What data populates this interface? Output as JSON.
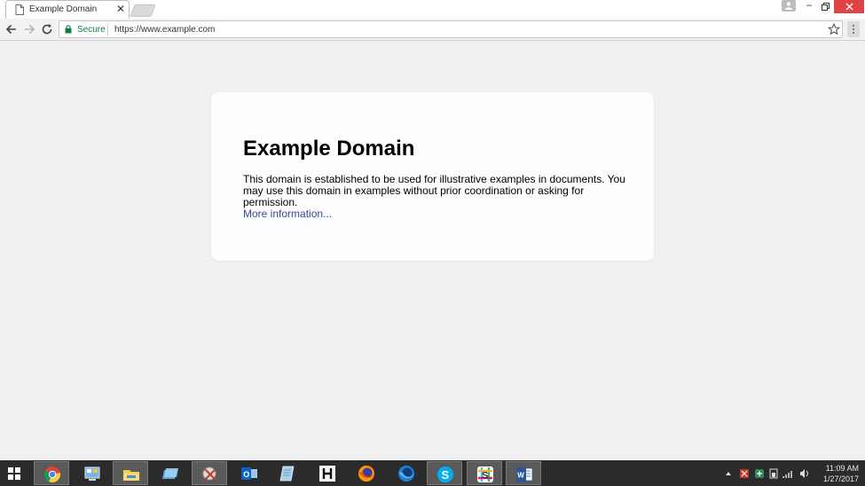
{
  "browser": {
    "tab": {
      "title": "Example Domain",
      "close_glyph": "✕"
    },
    "window_controls": {
      "minimize": "–"
    },
    "toolbar": {
      "secure_label": "Secure",
      "url": "https://www.example.com"
    }
  },
  "page": {
    "heading": "Example Domain",
    "body": "This domain is established to be used for illustrative examples in documents. You may use this domain in examples without prior coordination or asking for permission.",
    "link": "More information..."
  },
  "taskbar": {
    "apps": [
      {
        "name": "chrome-icon",
        "active": true
      },
      {
        "name": "control-panel-icon",
        "active": false
      },
      {
        "name": "file-explorer-icon",
        "active": false
      },
      {
        "name": "folder-app-icon",
        "active": false
      },
      {
        "name": "snipping-tool-icon",
        "active": true
      },
      {
        "name": "outlook-icon",
        "active": false
      },
      {
        "name": "notepad-icon",
        "active": false
      },
      {
        "name": "h-app-icon",
        "active": false
      },
      {
        "name": "firefox-icon",
        "active": false
      },
      {
        "name": "firefox-developer-icon",
        "active": false
      },
      {
        "name": "skype-icon",
        "active": true
      },
      {
        "name": "slack-icon",
        "active": true
      },
      {
        "name": "word-icon",
        "active": true
      }
    ],
    "tray": {
      "time": "11:09 AM",
      "date": "1/27/2017"
    }
  },
  "colors": {
    "page_background": "#f0f0f2",
    "card_background": "#fdfdff",
    "link": "#38488f",
    "secure_green": "#0b8043",
    "taskbar": "#2b2b2b",
    "close_red": "#e04343"
  }
}
